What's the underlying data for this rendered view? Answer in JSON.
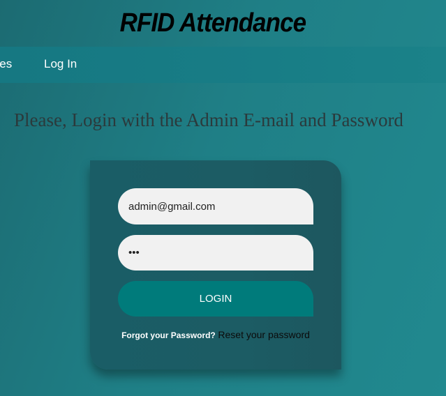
{
  "header": {
    "title": "RFID Attendance"
  },
  "nav": {
    "services_label": "ices",
    "login_label": "Log In"
  },
  "main": {
    "prompt": "Please, Login with the Admin E-mail and Password"
  },
  "login_form": {
    "email_value": "admin@gmail.com",
    "password_value": "123",
    "login_label": "LOGIN",
    "forgot_label": "Forgot your Password?",
    "reset_link": "Reset your password"
  }
}
